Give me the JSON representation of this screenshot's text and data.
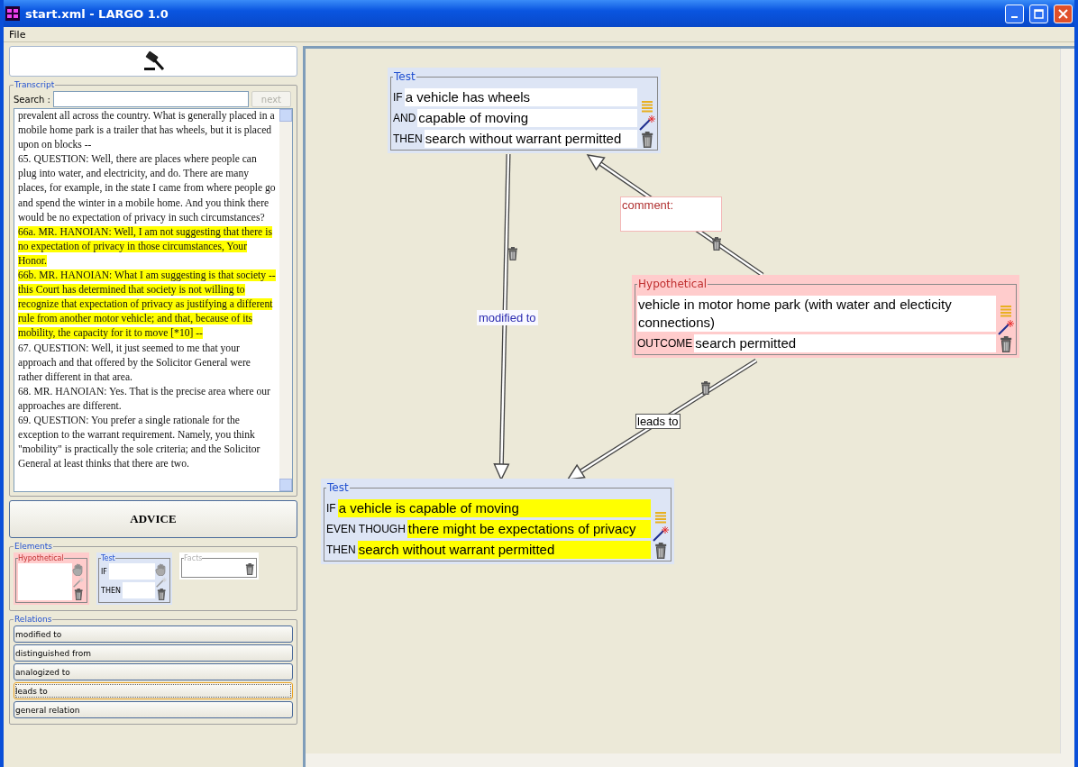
{
  "window": {
    "title": "start.xml - LARGO 1.0"
  },
  "menu": [
    "File"
  ],
  "transcript": {
    "legend": "Transcript",
    "search_label": "Search :",
    "next_button": {
      "label": "next",
      "disabled": true
    },
    "paragraphs": [
      {
        "text": "prevalent all across the country. What is generally placed in a mobile home park is a trailer that has wheels, but it is placed upon on blocks --",
        "highlighted": false
      },
      {
        "text": "65. QUESTION: Well, there are places where people can plug into water, and electricity, and do. There are many places, for example, in the state I came from where people go and spend the winter in a mobile home. And you think there would be no expectation of privacy in such circumstances?",
        "highlighted": false
      },
      {
        "text": "66a. MR. HANOIAN: Well, I am not suggesting that there is no expectation of privacy in those circumstances, Your Honor.",
        "highlighted": true
      },
      {
        "text": "66b. MR. HANOIAN: What I am suggesting is that society -- this Court has determined that society is not willing to recognize that expectation of privacy as justifying a different rule from another motor vehicle; and that, because of its mobility, the capacity for it to move [*10] --",
        "highlighted": true
      },
      {
        "text": "67. QUESTION: Well, it just seemed to me that your approach and that offered by the Solicitor General were rather different in that area.",
        "highlighted": false
      },
      {
        "text": "68. MR. HANOIAN: Yes. That is the precise area where our approaches are different.",
        "highlighted": false
      },
      {
        "text": "69. QUESTION: You prefer a single rationale for the exception to the warrant requirement. Namely, you think \"mobility\" is practically the sole criteria; and the Solicitor General at least thinks that there are two.",
        "highlighted": false
      }
    ]
  },
  "advice_button": "ADVICE",
  "elements": {
    "legend": "Elements",
    "items": [
      {
        "kind": "hypothetical",
        "title": "Hypothetical"
      },
      {
        "kind": "test",
        "title": "Test",
        "rows": [
          "IF",
          "THEN"
        ]
      },
      {
        "kind": "facts",
        "title": "Facts"
      }
    ]
  },
  "relations": {
    "legend": "Relations",
    "items": [
      {
        "label": "modified to",
        "selected": false
      },
      {
        "label": "distinguished from",
        "selected": false
      },
      {
        "label": "analogized to",
        "selected": false
      },
      {
        "label": "leads to",
        "selected": true
      },
      {
        "label": "general relation",
        "selected": false
      }
    ]
  },
  "canvas": {
    "nodes": [
      {
        "kind": "test",
        "title": "Test",
        "rows": [
          {
            "label": "IF",
            "text": "a vehicle has wheels",
            "highlighted": false
          },
          {
            "label": "AND",
            "text": "capable of moving",
            "highlighted": false
          },
          {
            "label": "THEN",
            "text": "search without warrant permitted",
            "highlighted": false
          }
        ]
      },
      {
        "kind": "comment",
        "title": "comment:"
      },
      {
        "kind": "hypothetical",
        "title": "Hypothetical",
        "rows": [
          {
            "text": "vehicle in motor home park (with water and electicity connections)",
            "highlighted": false
          },
          {
            "label": "OUTCOME",
            "text": "search permitted",
            "highlighted": false
          }
        ]
      },
      {
        "kind": "test",
        "title": "Test",
        "rows": [
          {
            "label": "IF",
            "text": "a vehicle is capable of moving",
            "highlighted": true
          },
          {
            "label": "EVEN THOUGH",
            "text": "there might be expectations of privacy",
            "highlighted": true
          },
          {
            "label": "THEN",
            "text": "search without warrant permitted",
            "highlighted": true
          }
        ]
      }
    ],
    "edges": [
      {
        "kind": "relation",
        "label": "modified to",
        "selected": false
      },
      {
        "kind": "comment"
      },
      {
        "kind": "relation",
        "label": "leads to",
        "selected": true
      }
    ]
  }
}
